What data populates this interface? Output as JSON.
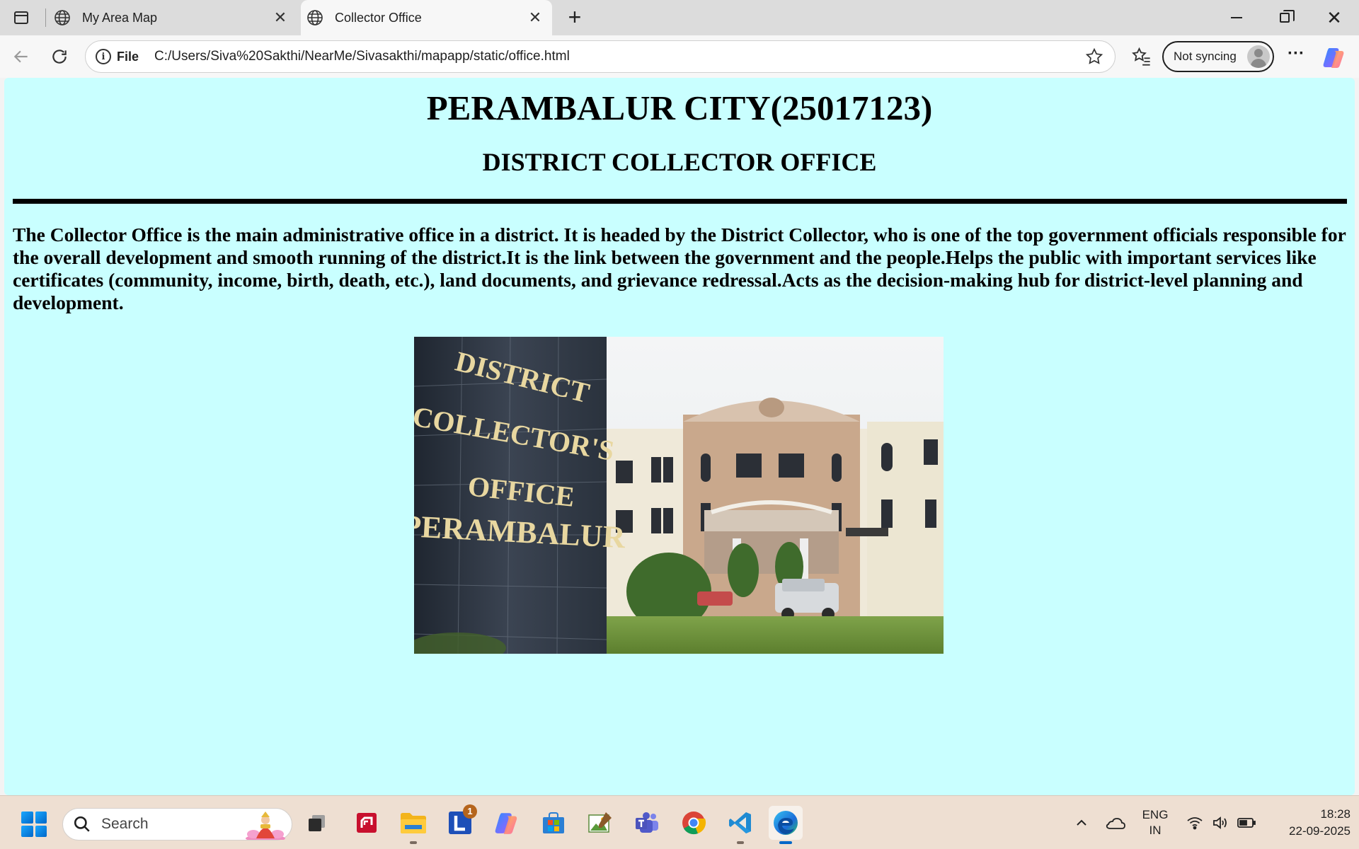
{
  "browser": {
    "tabs": [
      {
        "title": "My Area Map",
        "active": false
      },
      {
        "title": "Collector Office",
        "active": true
      }
    ],
    "address": {
      "scheme_label": "File",
      "url": "C:/Users/Siva%20Sakthi/NearMe/Sivasakthi/mapapp/static/office.html"
    },
    "profile_label": "Not syncing"
  },
  "page": {
    "background": "#c9ffff",
    "title": "PERAMBALUR CITY(25017123)",
    "subtitle": "DISTRICT COLLECTOR OFFICE",
    "description": "The Collector Office is the main administrative office in a district. It is headed by the District Collector, who is one of the top government officials responsible for the overall development and smooth running of the district.It is the link between the government and the people.Helps the public with important services like certificates (community, income, birth, death, etc.), land documents, and grievance redressal.Acts as the decision-making hub for district-level planning and development.",
    "photo": {
      "sign_lines": [
        "DISTRICT",
        "COLLECTOR'S",
        "OFFICE",
        "PERAMBALUR"
      ]
    }
  },
  "taskbar": {
    "search_placeholder": "Search",
    "apps": [
      {
        "name": "task-view",
        "icon": "task-view-icon"
      },
      {
        "name": "amd-software",
        "icon": "amd-icon"
      },
      {
        "name": "file-explorer",
        "icon": "folder-icon"
      },
      {
        "name": "l-app",
        "icon": "l-app-icon",
        "badge": "1"
      },
      {
        "name": "copilot",
        "icon": "copilot-icon"
      },
      {
        "name": "microsoft-store",
        "icon": "store-icon"
      },
      {
        "name": "photos-editor",
        "icon": "photo-editor-icon"
      },
      {
        "name": "teams",
        "icon": "teams-icon"
      },
      {
        "name": "chrome",
        "icon": "chrome-icon"
      },
      {
        "name": "vscode",
        "icon": "vscode-icon"
      },
      {
        "name": "edge",
        "icon": "edge-icon",
        "active": true
      }
    ],
    "language": {
      "line1": "ENG",
      "line2": "IN"
    },
    "time": "18:28",
    "date": "22-09-2025"
  }
}
